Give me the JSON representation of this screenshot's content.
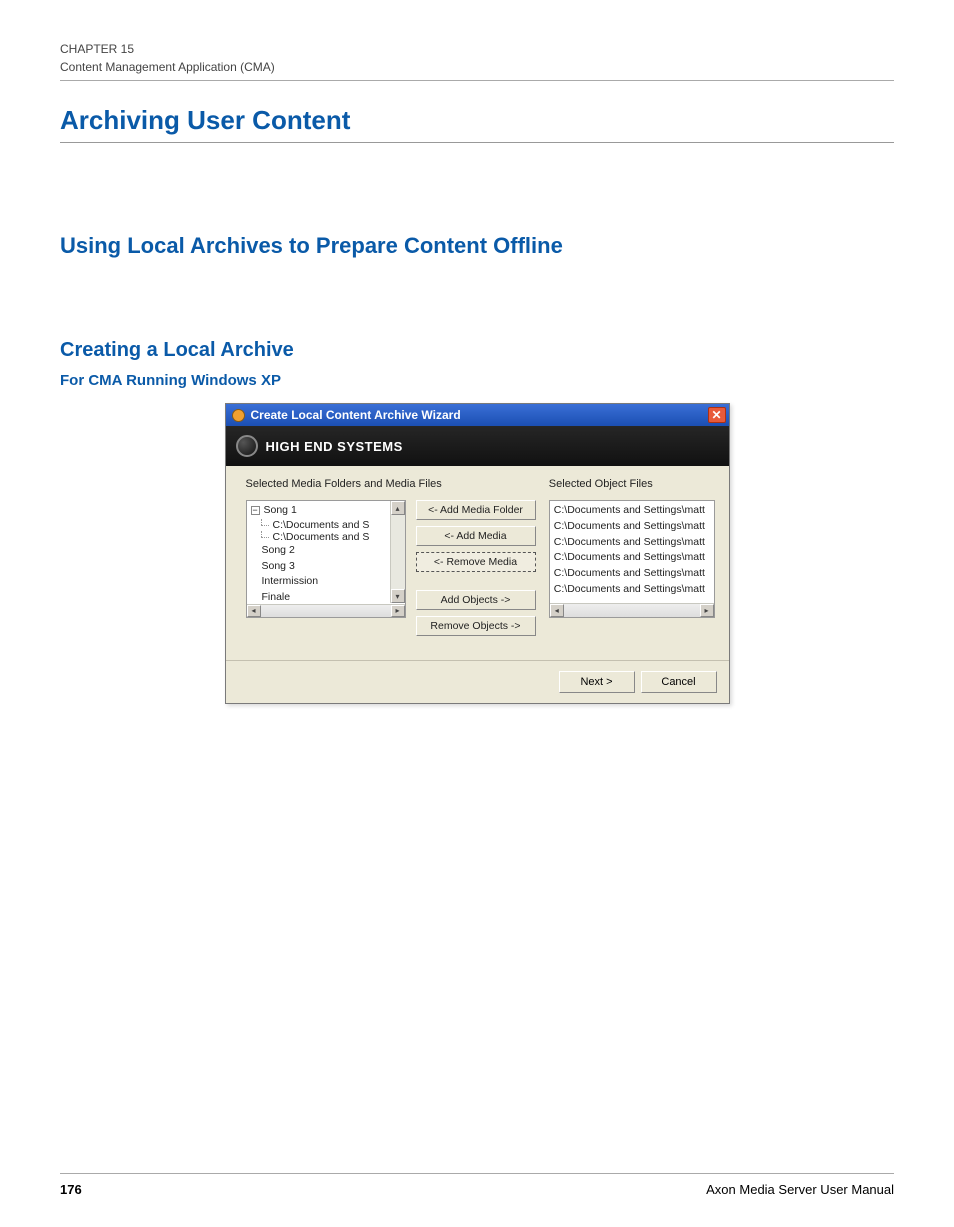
{
  "header": {
    "chapter": "CHAPTER 15",
    "subtitle": "Content Management Application (CMA)"
  },
  "headings": {
    "h1": "Archiving User Content",
    "h2": "Using Local Archives to Prepare Content Offline",
    "h3": "Creating a Local Archive",
    "h4": "For CMA Running Windows XP"
  },
  "wizard": {
    "title": "Create Local Content Archive Wizard",
    "brand": "HIGH END SYSTEMS",
    "left_label": "Selected Media Folders and Media Files",
    "right_label": "Selected Object Files",
    "tree": {
      "root": "Song 1",
      "children": [
        "C:\\Documents and S",
        "C:\\Documents and S"
      ],
      "siblings": [
        "Song 2",
        "Song 3",
        "Intermission",
        "Finale"
      ]
    },
    "buttons": {
      "add_folder": "<- Add Media Folder",
      "add_media": "<- Add Media",
      "remove_media": "<- Remove Media",
      "add_objects": "Add Objects ->",
      "remove_objects": "Remove Objects ->"
    },
    "object_files": [
      "C:\\Documents and Settings\\matt",
      "C:\\Documents and Settings\\matt",
      "C:\\Documents and Settings\\matt",
      "C:\\Documents and Settings\\matt",
      "C:\\Documents and Settings\\matt",
      "C:\\Documents and Settings\\matt"
    ],
    "footer": {
      "next": "Next >",
      "cancel": "Cancel"
    }
  },
  "footer": {
    "page": "176",
    "manual": "Axon Media Server User Manual"
  }
}
